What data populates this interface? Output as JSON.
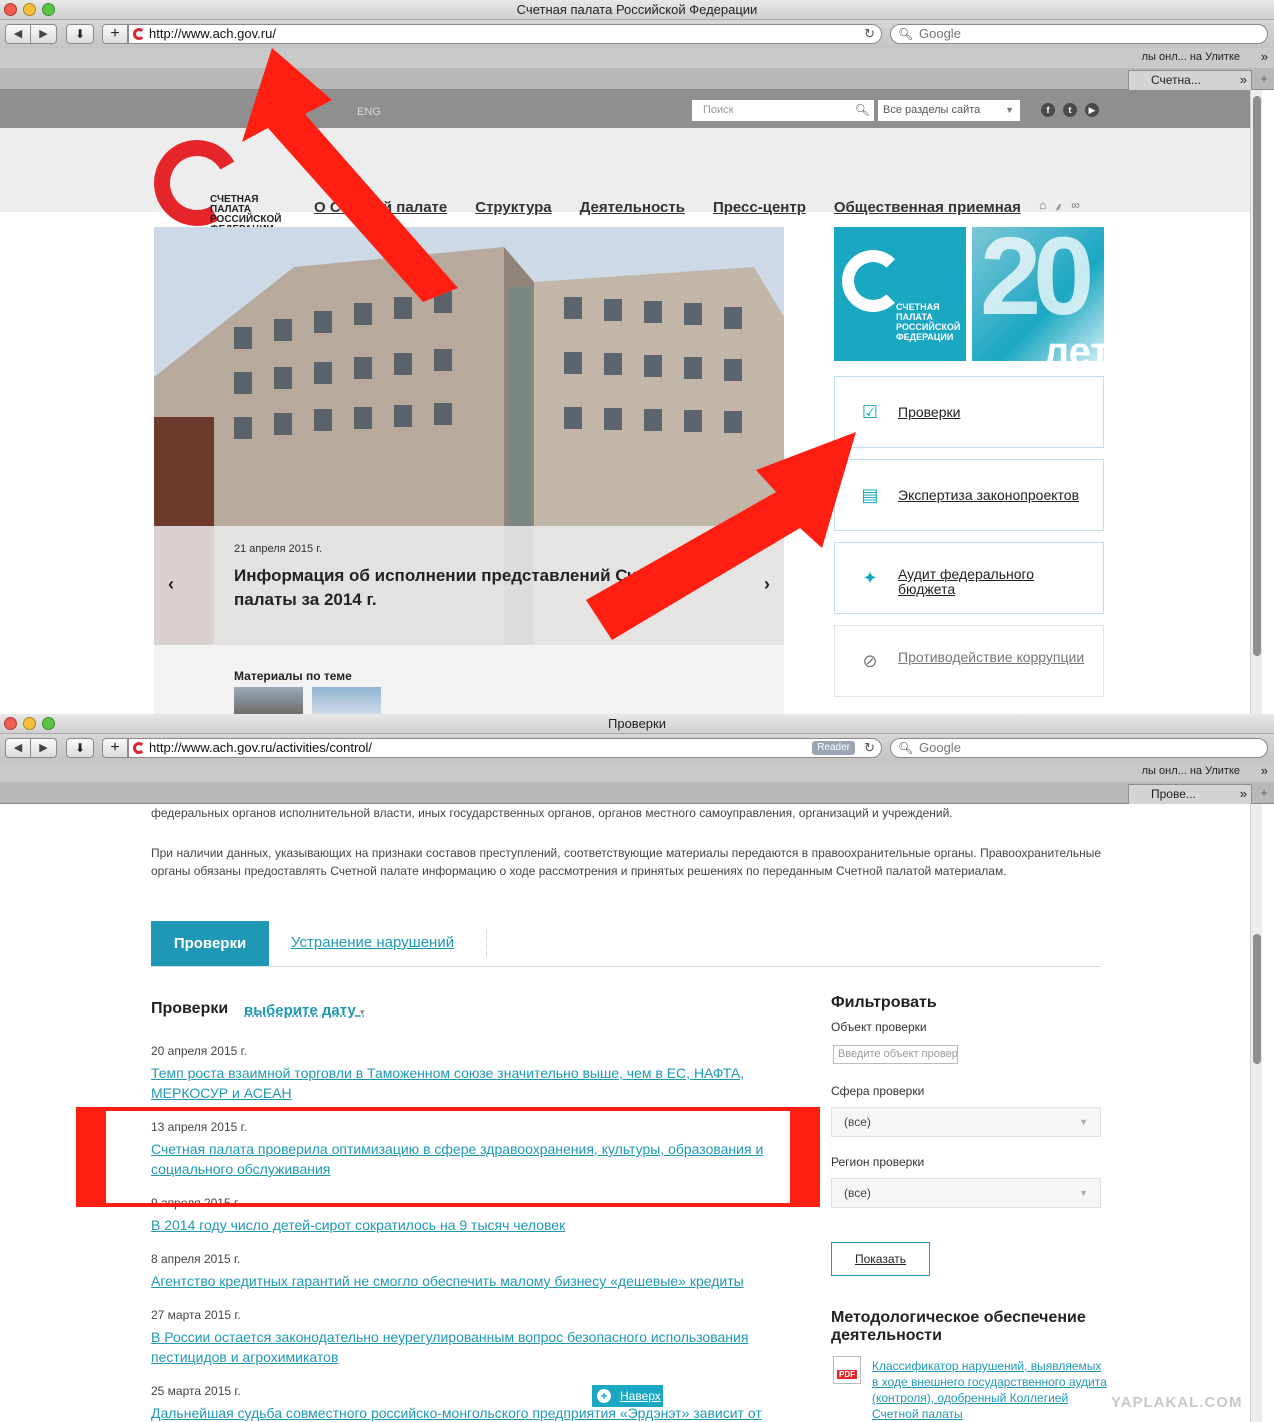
{
  "window1": {
    "title": "Счетная палата Российской Федерации",
    "url": "http://www.ach.gov.ru/",
    "search_placeholder": "Google",
    "bookmark": "лы онл... на Улитке",
    "tab_label": "Счетна..."
  },
  "site": {
    "lang": "ENG",
    "search_placeholder": "Поиск",
    "section_select": "Все разделы сайта",
    "logo_text": "СЧЕТНАЯ ПАЛАТА РОССИЙСКОЙ ФЕДЕРАЦИИ",
    "nav": [
      "О Счетной палате",
      "Структура",
      "Деятельность",
      "Пресс-центр",
      "Общественная приемная"
    ],
    "slider": {
      "date": "21 апреля 2015 г.",
      "title": "Информация об исполнении представлений Счетной палаты за 2014 г.",
      "materials": "Материалы по теме"
    },
    "promo": {
      "logo_text": "СЧЕТНАЯ ПАЛАТА РОССИЙСКОЙ ФЕДЕРАЦИИ",
      "anniversary_number": "20",
      "anniversary_word": "лет"
    },
    "services": [
      "Проверки",
      "Экспертиза законопроектов",
      "Аудит федерального бюджета",
      "Противодействие коррупции"
    ]
  },
  "window2": {
    "title": "Проверки",
    "url": "http://www.ach.gov.ru/activities/control/",
    "reader": "Reader",
    "search_placeholder": "Google",
    "bookmark": "лы онл... на Улитке",
    "tab_label": "Прове..."
  },
  "page2": {
    "para1": "федеральных органов исполнительной власти, иных государственных органов, органов местного самоуправления, организаций и учреждений.",
    "para2": "При наличии данных, указывающих на признаки составов преступлений, соответствующие материалы передаются в правоохранительные органы. Правоохранительные органы обязаны предоставлять Счетной палате информацию о ходе рассмотрения и принятых решениях по переданным Счетной палатой материалам.",
    "tab_active": "Проверки",
    "tab_other": "Устранение нарушений",
    "list_title": "Проверки",
    "date_picker": "выберите дату",
    "items": [
      {
        "date": "20 апреля 2015 г.",
        "title": "Темп роста взаимной торговли в Таможенном союзе значительно выше, чем в ЕС, НАФТА, МЕРКОСУР и АСЕАН"
      },
      {
        "date": "13 апреля 2015 г.",
        "title": "Счетная палата проверила оптимизацию в сфере здравоохранения, культуры, образования и социального обслуживания"
      },
      {
        "date": "9 апреля 2015 г.",
        "title": "В 2014 году число детей-сирот сократилось на 9 тысяч человек"
      },
      {
        "date": "8 апреля 2015 г.",
        "title": "Агентство кредитных гарантий не смогло обеспечить малому бизнесу «дешевые» кредиты"
      },
      {
        "date": "27 марта 2015 г.",
        "title": "В России остается законодательно неурегулированным вопрос безопасного использования пестицидов и агрохимикатов"
      },
      {
        "date": "25 марта 2015 г.",
        "title": "Дальнейшая судьба совместного российско-монгольского предприятия «Эрдэнэт» зависит от"
      }
    ],
    "filter": {
      "title": "Фильтровать",
      "object_label": "Объект проверки",
      "object_placeholder": "Введите объект проверки",
      "sphere_label": "Сфера проверки",
      "sphere_value": "(все)",
      "region_label": "Регион проверки",
      "region_value": "(все)",
      "show_button": "Показать"
    },
    "method_title": "Методологическое обеспечение деятельности",
    "pdf_label": "PDF",
    "method_link": "Классификатор нарушений, выявляемых в ходе внешнего государственного аудита (контроля), одобренный Коллегией Счетной палаты",
    "to_top": "Наверх",
    "watermark": "YAPLAKAL.COM"
  },
  "colors": {
    "brand_red": "#e5252a",
    "teal": "#1e98b4",
    "annotation_red": "#ff1e12"
  }
}
